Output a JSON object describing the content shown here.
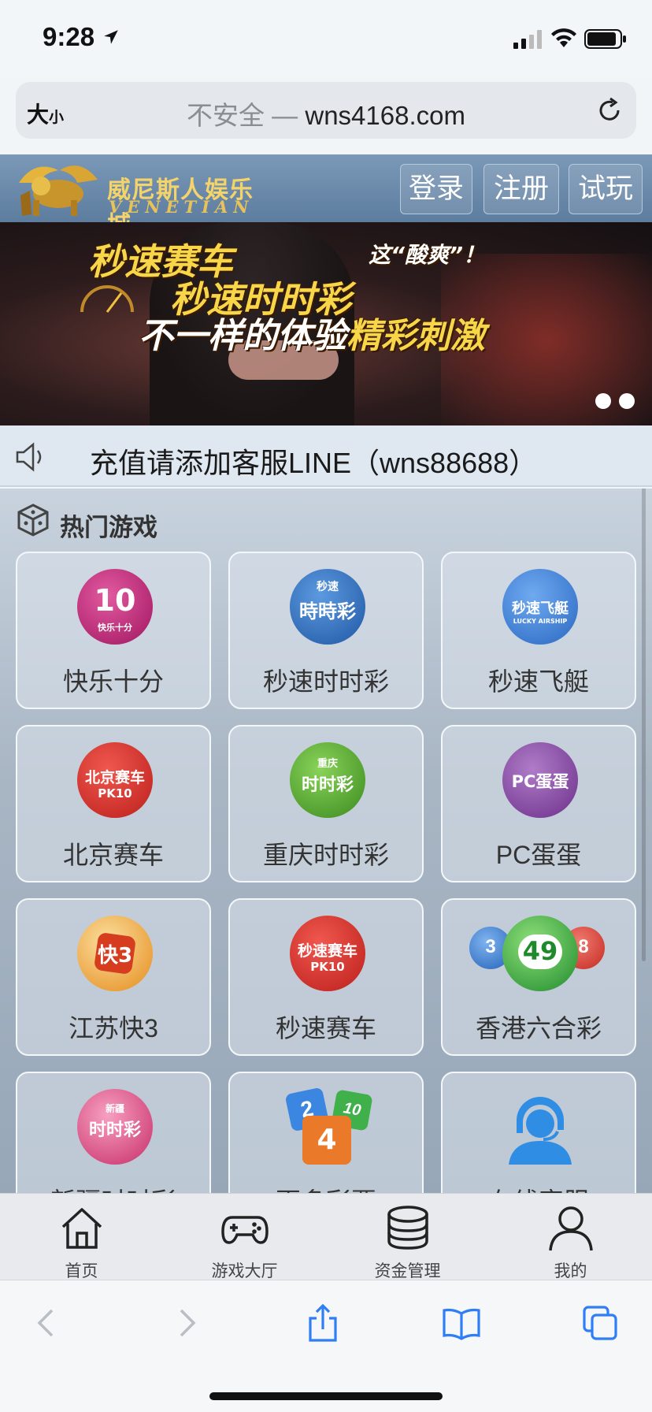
{
  "status_bar": {
    "time": "9:28"
  },
  "browser": {
    "text_size_label": "大",
    "text_size_small": "小",
    "security": "不安全 —",
    "domain": "wns4168.com"
  },
  "site": {
    "logo_cn": "威尼斯人娱乐城",
    "logo_en": "VENETIAN",
    "login": "登录",
    "register": "注册",
    "trial": "试玩"
  },
  "banner": {
    "line1": "秒速赛车",
    "line2": "秒速时时彩",
    "line3_prefix": "不一样的体验",
    "line3_highlight": "精彩刺激",
    "tag": "这“酸爽”！"
  },
  "notice": {
    "text": "充值请添加客服LINE（wns88688）"
  },
  "section": {
    "title": "热门游戏"
  },
  "games": [
    {
      "name": "快乐十分",
      "icon": "kuaile-shifen-icon",
      "color": "#c2237a",
      "icon_text": "10",
      "icon_sub": "快乐十分"
    },
    {
      "name": "秒速时时彩",
      "icon": "miaosu-shishicai-icon",
      "color": "#2f6fbd",
      "icon_text": "時時彩",
      "icon_sub": "秒速"
    },
    {
      "name": "秒速飞艇",
      "icon": "miaosu-feiting-icon",
      "color": "#3d7fd6",
      "icon_text": "秒速飞艇",
      "icon_sub": "LUCKY AIRSHIP"
    },
    {
      "name": "北京赛车",
      "icon": "beijing-saiche-icon",
      "color": "#d8312a",
      "icon_text": "北京赛车",
      "icon_sub": "PK10"
    },
    {
      "name": "重庆时时彩",
      "icon": "chongqing-shishicai-icon",
      "color": "#4fa52b",
      "icon_text": "时时彩",
      "icon_sub": "重庆"
    },
    {
      "name": "PC蛋蛋",
      "icon": "pc-dandan-icon",
      "color": "#8a4ba7",
      "icon_text": "PC蛋蛋",
      "icon_sub": ""
    },
    {
      "name": "江苏快3",
      "icon": "jiangsu-kuai3-icon",
      "color": "#e88a1c",
      "icon_text": "快3",
      "icon_sub": ""
    },
    {
      "name": "秒速赛车",
      "icon": "miaosu-saiche-icon",
      "color": "#d8312a",
      "icon_text": "秒速赛车",
      "icon_sub": "PK10"
    },
    {
      "name": "香港六合彩",
      "icon": "hk-liuhecai-icon",
      "color": "#2da53a",
      "icon_text": "49",
      "icon_sub": ""
    },
    {
      "name": "新疆时时彩",
      "icon": "xinjiang-shishicai-icon",
      "color": "#d6457a",
      "icon_text": "时时彩",
      "icon_sub": "新疆"
    },
    {
      "name": "更多彩票",
      "icon": "more-lottery-icon",
      "color": "#e87a2a",
      "icon_text": "4",
      "icon_sub": ""
    },
    {
      "name": "在线客服",
      "icon": "customer-service-icon",
      "color": "#2f8de4",
      "icon_text": "",
      "icon_sub": ""
    }
  ],
  "tabbar": {
    "home": "首页",
    "lobby": "游戏大厅",
    "funds": "资金管理",
    "mine": "我的"
  },
  "colors": {
    "header_bg": "#6a89aa",
    "banner_gold": "#f7d64a",
    "ios_blue": "#2f7ef6"
  }
}
